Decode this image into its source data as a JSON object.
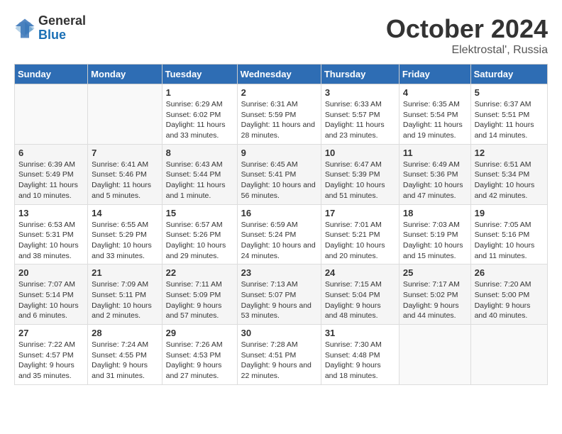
{
  "header": {
    "logo_general": "General",
    "logo_blue": "Blue",
    "month": "October 2024",
    "location": "Elektrostal', Russia"
  },
  "days_of_week": [
    "Sunday",
    "Monday",
    "Tuesday",
    "Wednesday",
    "Thursday",
    "Friday",
    "Saturday"
  ],
  "weeks": [
    [
      {
        "day": null
      },
      {
        "day": null
      },
      {
        "day": 1,
        "sunrise": "Sunrise: 6:29 AM",
        "sunset": "Sunset: 6:02 PM",
        "daylight": "Daylight: 11 hours and 33 minutes."
      },
      {
        "day": 2,
        "sunrise": "Sunrise: 6:31 AM",
        "sunset": "Sunset: 5:59 PM",
        "daylight": "Daylight: 11 hours and 28 minutes."
      },
      {
        "day": 3,
        "sunrise": "Sunrise: 6:33 AM",
        "sunset": "Sunset: 5:57 PM",
        "daylight": "Daylight: 11 hours and 23 minutes."
      },
      {
        "day": 4,
        "sunrise": "Sunrise: 6:35 AM",
        "sunset": "Sunset: 5:54 PM",
        "daylight": "Daylight: 11 hours and 19 minutes."
      },
      {
        "day": 5,
        "sunrise": "Sunrise: 6:37 AM",
        "sunset": "Sunset: 5:51 PM",
        "daylight": "Daylight: 11 hours and 14 minutes."
      }
    ],
    [
      {
        "day": 6,
        "sunrise": "Sunrise: 6:39 AM",
        "sunset": "Sunset: 5:49 PM",
        "daylight": "Daylight: 11 hours and 10 minutes."
      },
      {
        "day": 7,
        "sunrise": "Sunrise: 6:41 AM",
        "sunset": "Sunset: 5:46 PM",
        "daylight": "Daylight: 11 hours and 5 minutes."
      },
      {
        "day": 8,
        "sunrise": "Sunrise: 6:43 AM",
        "sunset": "Sunset: 5:44 PM",
        "daylight": "Daylight: 11 hours and 1 minute."
      },
      {
        "day": 9,
        "sunrise": "Sunrise: 6:45 AM",
        "sunset": "Sunset: 5:41 PM",
        "daylight": "Daylight: 10 hours and 56 minutes."
      },
      {
        "day": 10,
        "sunrise": "Sunrise: 6:47 AM",
        "sunset": "Sunset: 5:39 PM",
        "daylight": "Daylight: 10 hours and 51 minutes."
      },
      {
        "day": 11,
        "sunrise": "Sunrise: 6:49 AM",
        "sunset": "Sunset: 5:36 PM",
        "daylight": "Daylight: 10 hours and 47 minutes."
      },
      {
        "day": 12,
        "sunrise": "Sunrise: 6:51 AM",
        "sunset": "Sunset: 5:34 PM",
        "daylight": "Daylight: 10 hours and 42 minutes."
      }
    ],
    [
      {
        "day": 13,
        "sunrise": "Sunrise: 6:53 AM",
        "sunset": "Sunset: 5:31 PM",
        "daylight": "Daylight: 10 hours and 38 minutes."
      },
      {
        "day": 14,
        "sunrise": "Sunrise: 6:55 AM",
        "sunset": "Sunset: 5:29 PM",
        "daylight": "Daylight: 10 hours and 33 minutes."
      },
      {
        "day": 15,
        "sunrise": "Sunrise: 6:57 AM",
        "sunset": "Sunset: 5:26 PM",
        "daylight": "Daylight: 10 hours and 29 minutes."
      },
      {
        "day": 16,
        "sunrise": "Sunrise: 6:59 AM",
        "sunset": "Sunset: 5:24 PM",
        "daylight": "Daylight: 10 hours and 24 minutes."
      },
      {
        "day": 17,
        "sunrise": "Sunrise: 7:01 AM",
        "sunset": "Sunset: 5:21 PM",
        "daylight": "Daylight: 10 hours and 20 minutes."
      },
      {
        "day": 18,
        "sunrise": "Sunrise: 7:03 AM",
        "sunset": "Sunset: 5:19 PM",
        "daylight": "Daylight: 10 hours and 15 minutes."
      },
      {
        "day": 19,
        "sunrise": "Sunrise: 7:05 AM",
        "sunset": "Sunset: 5:16 PM",
        "daylight": "Daylight: 10 hours and 11 minutes."
      }
    ],
    [
      {
        "day": 20,
        "sunrise": "Sunrise: 7:07 AM",
        "sunset": "Sunset: 5:14 PM",
        "daylight": "Daylight: 10 hours and 6 minutes."
      },
      {
        "day": 21,
        "sunrise": "Sunrise: 7:09 AM",
        "sunset": "Sunset: 5:11 PM",
        "daylight": "Daylight: 10 hours and 2 minutes."
      },
      {
        "day": 22,
        "sunrise": "Sunrise: 7:11 AM",
        "sunset": "Sunset: 5:09 PM",
        "daylight": "Daylight: 9 hours and 57 minutes."
      },
      {
        "day": 23,
        "sunrise": "Sunrise: 7:13 AM",
        "sunset": "Sunset: 5:07 PM",
        "daylight": "Daylight: 9 hours and 53 minutes."
      },
      {
        "day": 24,
        "sunrise": "Sunrise: 7:15 AM",
        "sunset": "Sunset: 5:04 PM",
        "daylight": "Daylight: 9 hours and 48 minutes."
      },
      {
        "day": 25,
        "sunrise": "Sunrise: 7:17 AM",
        "sunset": "Sunset: 5:02 PM",
        "daylight": "Daylight: 9 hours and 44 minutes."
      },
      {
        "day": 26,
        "sunrise": "Sunrise: 7:20 AM",
        "sunset": "Sunset: 5:00 PM",
        "daylight": "Daylight: 9 hours and 40 minutes."
      }
    ],
    [
      {
        "day": 27,
        "sunrise": "Sunrise: 7:22 AM",
        "sunset": "Sunset: 4:57 PM",
        "daylight": "Daylight: 9 hours and 35 minutes."
      },
      {
        "day": 28,
        "sunrise": "Sunrise: 7:24 AM",
        "sunset": "Sunset: 4:55 PM",
        "daylight": "Daylight: 9 hours and 31 minutes."
      },
      {
        "day": 29,
        "sunrise": "Sunrise: 7:26 AM",
        "sunset": "Sunset: 4:53 PM",
        "daylight": "Daylight: 9 hours and 27 minutes."
      },
      {
        "day": 30,
        "sunrise": "Sunrise: 7:28 AM",
        "sunset": "Sunset: 4:51 PM",
        "daylight": "Daylight: 9 hours and 22 minutes."
      },
      {
        "day": 31,
        "sunrise": "Sunrise: 7:30 AM",
        "sunset": "Sunset: 4:48 PM",
        "daylight": "Daylight: 9 hours and 18 minutes."
      },
      {
        "day": null
      },
      {
        "day": null
      }
    ]
  ]
}
